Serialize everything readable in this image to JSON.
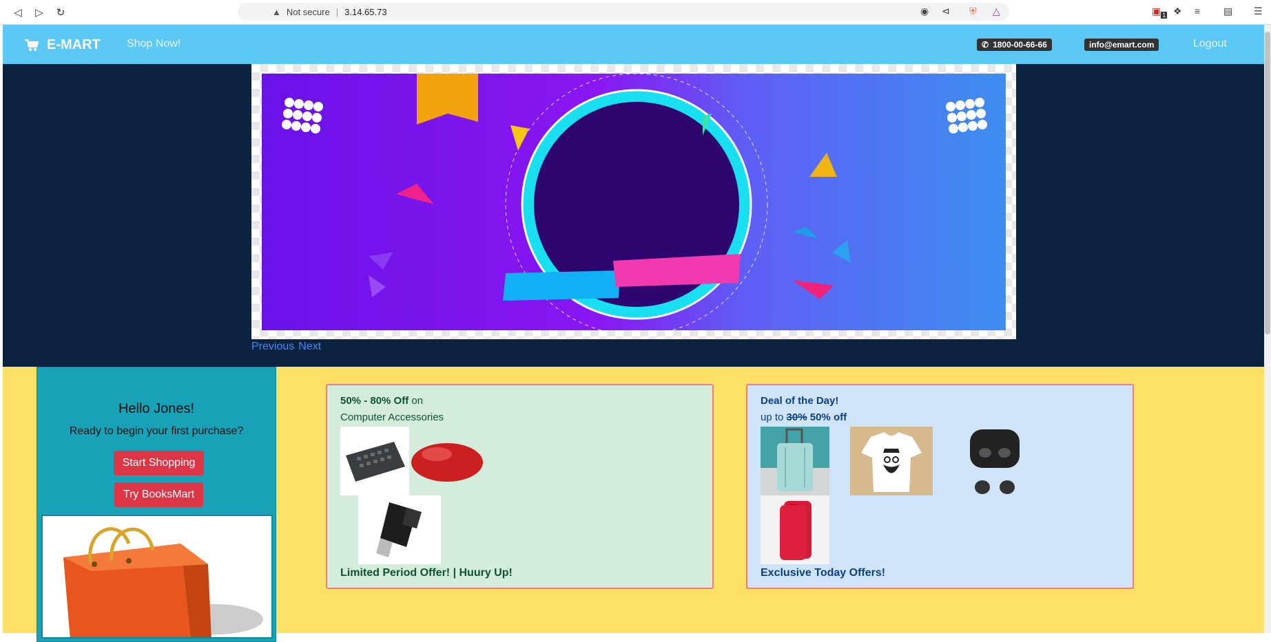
{
  "browser": {
    "security_label": "Not secure",
    "url": "3.14.65.73",
    "extension_badge": "1"
  },
  "navbar": {
    "brand": "E-MART",
    "shop_now": "Shop Now!",
    "phone": "1800-00-66-66",
    "email": "info@emart.com",
    "logout": "Logout"
  },
  "carousel": {
    "previous": "Previous",
    "next": "Next"
  },
  "greeting": {
    "title": "Hello Jones!",
    "subtitle": "Ready to begin your first purchase?",
    "start_shopping": "Start Shopping",
    "try_booksmart": "Try BooksMart"
  },
  "offer_computer": {
    "discount": "50% - 80% Off",
    "on": "on",
    "category": "Computer Accessories",
    "footer": "Limited Period Offer! | Huury Up!"
  },
  "offer_deal": {
    "title": "Deal of the Day!",
    "up_to": "up to",
    "old_pct": "30%",
    "new_pct": "50% off",
    "footer": "Exclusive Today Offers!"
  },
  "colors": {
    "navbar": "#5bc8f5",
    "dark_band": "#0b2240",
    "yellow_band": "#fde066",
    "teal_card": "#17a2b8",
    "red_button": "#dc3545"
  }
}
